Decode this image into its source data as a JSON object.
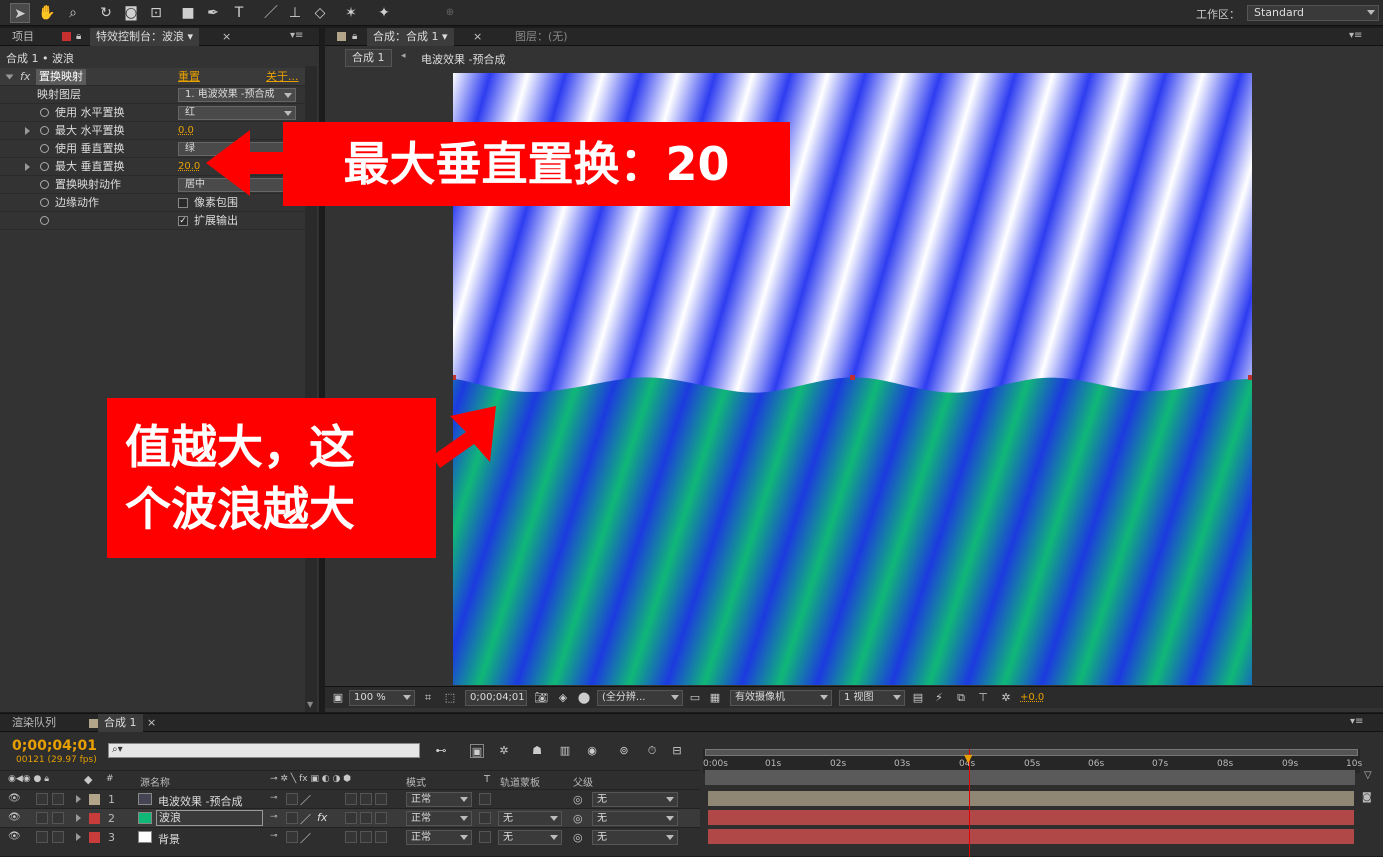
{
  "toolbar": {
    "tools": [
      "selection-tool-icon",
      "hand-tool-icon",
      "zoom-tool-icon",
      "rotate-tool-icon",
      "camera-tool-icon",
      "pan-behind-tool-icon",
      "rectangle-tool-icon",
      "pen-tool-icon",
      "type-tool-icon",
      "brush-tool-icon",
      "clone-stamp-tool-icon",
      "eraser-tool-icon",
      "roto-brush-tool-icon",
      "puppet-tool-icon"
    ],
    "workspace_label": "工作区：",
    "workspace_value": "Standard"
  },
  "left_panel": {
    "tab_project": "项目",
    "tab_effect_controls": "特效控制台：波浪",
    "subtitle": "合成 1 • 波浪",
    "effect_name": "置换映射",
    "reset_label": "重置",
    "about_label": "关于...",
    "fx_label": "fx",
    "rows": [
      {
        "label": "映射图层",
        "value": "1. 电波效果 -预合成"
      },
      {
        "label": "使用 水平置换",
        "value": "红"
      },
      {
        "label": "最大 水平置换",
        "value": "0.0"
      },
      {
        "label": "使用 垂直置换",
        "value": "绿"
      },
      {
        "label": "最大 垂直置换",
        "value": "20.0"
      },
      {
        "label": "置换映射动作",
        "value": "居中"
      },
      {
        "label": "边缘动作",
        "value": "像素包围"
      },
      {
        "label": "",
        "value": "扩展输出"
      }
    ]
  },
  "viewer": {
    "tab_comp": "合成：合成 1",
    "tab_layer": "图层：(无)",
    "breadcrumb_comp": "合成 1",
    "breadcrumb_nested": "电波效果 -预合成",
    "zoom": "100 %",
    "timecode": "0;00;04;01",
    "resolution": "(全分辨...",
    "camera": "有效摄像机",
    "views": "1 视图",
    "exposure": "+0.0"
  },
  "annotations": {
    "callout_top": "最大垂直置换：20",
    "callout_bottom_line1": "值越大，这",
    "callout_bottom_line2": "个波浪越大"
  },
  "timeline": {
    "tab_render": "渲染队列",
    "tab_comp": "合成 1",
    "timecode": "0;00;04;01",
    "frame_info": "00121 (29.97 fps)",
    "search_placeholder": "",
    "col_source": "源名称",
    "col_mode": "模式",
    "col_t": "T",
    "col_trkmat": "轨道蒙板",
    "col_parent": "父级",
    "ruler_ticks": [
      "0:00s",
      "01s",
      "02s",
      "03s",
      "04s",
      "05s",
      "06s",
      "07s",
      "08s",
      "09s",
      "10s"
    ],
    "layers": [
      {
        "num": "1",
        "name": "电波效果 -预合成",
        "mode": "正常",
        "trkmat": "",
        "parent": "无",
        "color": "#b3a58a"
      },
      {
        "num": "2",
        "name": "波浪",
        "mode": "正常",
        "trkmat": "无",
        "parent": "无",
        "color": "#c83c3c"
      },
      {
        "num": "3",
        "name": "背景",
        "mode": "正常",
        "trkmat": "无",
        "parent": "无",
        "color": "#c83c3c"
      }
    ],
    "playhead_time": "04s"
  }
}
